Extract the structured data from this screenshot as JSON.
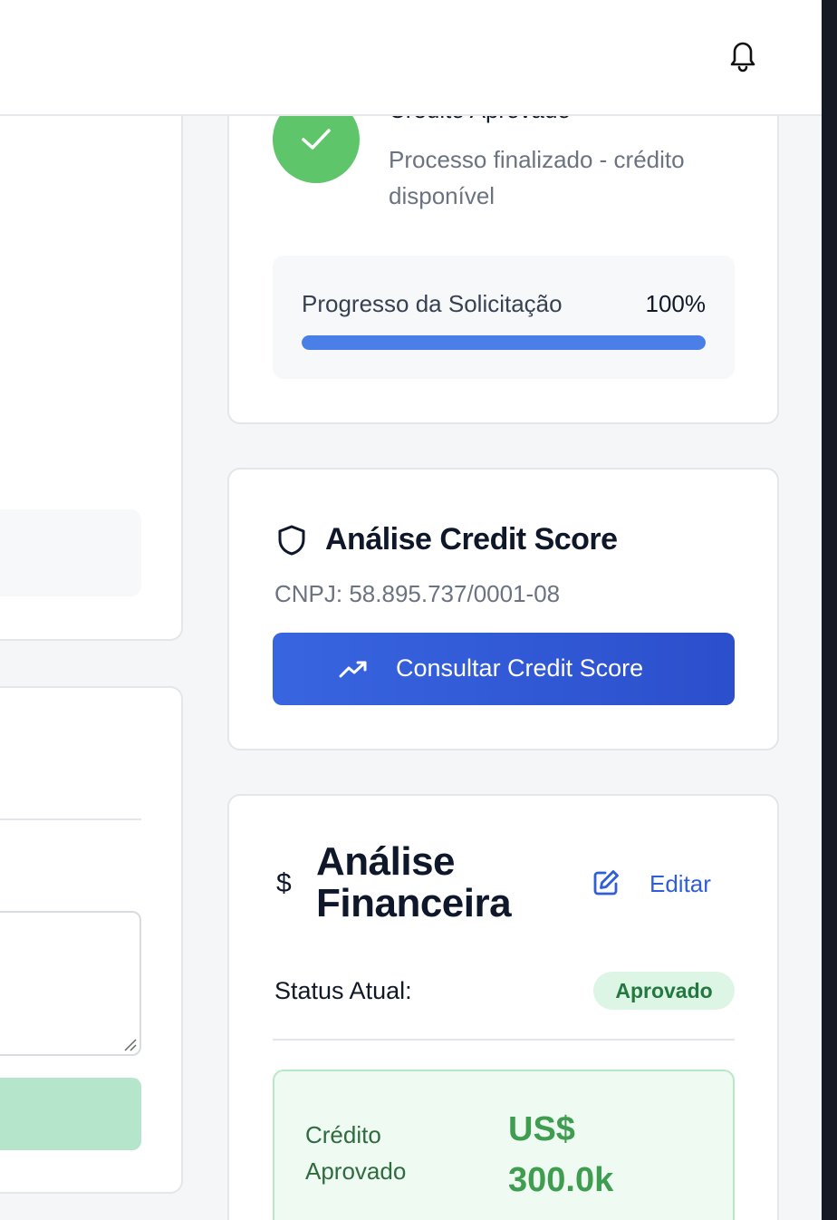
{
  "header": {
    "notification_icon": "bell-icon"
  },
  "status_card": {
    "title": "Crédito Aprovado",
    "description": "Processo finalizado - crédito disponível",
    "icon": "check-icon",
    "progress": {
      "label": "Progresso da Solicitação",
      "value_text": "100%",
      "fraction": 1.0
    }
  },
  "credit_score_card": {
    "icon": "shield-icon",
    "title": "Análise Credit Score",
    "cnpj": "CNPJ: 58.895.737/0001-08",
    "button_icon": "trending-up-icon",
    "button_label": "Consultar Credit Score"
  },
  "financial_card": {
    "icon": "dollar-icon",
    "icon_glyph": "$",
    "title": "Análise Financeira",
    "edit_icon": "edit-icon",
    "edit_label": "Editar",
    "status_label": "Status Atual:",
    "status_badge": "Aprovado",
    "credit_label": "Crédito Aprovado",
    "credit_value": "US$ 300.0k"
  },
  "colors": {
    "primary_blue": "#3865e0",
    "success_green": "#5fc56a",
    "progress_blue": "#4a7fe8",
    "badge_bg": "#dcf5e4",
    "badge_text": "#23773f"
  }
}
